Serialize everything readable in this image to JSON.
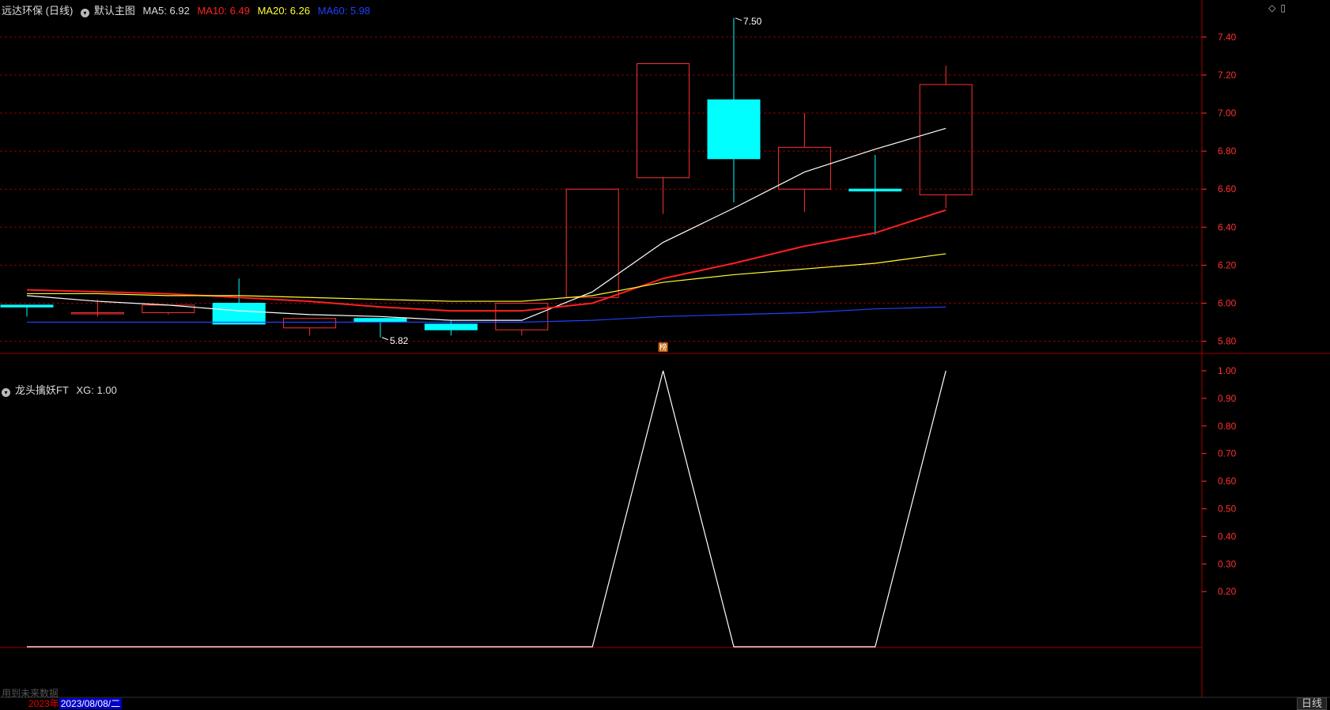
{
  "header": {
    "stock_name": "远达环保 (日线)",
    "template_label": "默认主图",
    "ma5": {
      "label": "MA5:",
      "value": "6.92",
      "color": "#ffffff"
    },
    "ma10": {
      "label": "MA10:",
      "value": "6.49",
      "color": "#ff2020"
    },
    "ma20": {
      "label": "MA20:",
      "value": "6.26",
      "color": "#ffff30"
    },
    "ma60": {
      "label": "MA60:",
      "value": "5.98",
      "color": "#2040ff"
    }
  },
  "indicator_header": {
    "name": "龙头擒妖FT",
    "xg_label": "XG:",
    "xg_value": "1.00"
  },
  "window_controls": {
    "diamond": "◇",
    "restore": "▯"
  },
  "footer": {
    "note": "用到未来数据",
    "year": "2023年",
    "current_date": "2023/08/08/二",
    "period_button": "日线"
  },
  "colors": {
    "up": "#ff3030",
    "down": "#00ffff",
    "grid": "#8b0000",
    "axis_text": "#ff3030",
    "border": "#a00000",
    "annotation": "#ffffff",
    "badge_bg": "#c06010"
  },
  "chart_data": [
    {
      "type": "candlestick",
      "title": "远达环保 (日线)",
      "ylim": [
        5.74,
        7.52
      ],
      "y_ticks": [
        "7.40",
        "7.20",
        "7.00",
        "6.80",
        "6.60",
        "6.40",
        "6.20",
        "6.00",
        "5.80"
      ],
      "y_tick_values": [
        7.4,
        7.2,
        7.0,
        6.8,
        6.6,
        6.4,
        6.2,
        6.0,
        5.8
      ],
      "grid": true,
      "candles": [
        {
          "open": 5.99,
          "close": 5.98,
          "high": 5.99,
          "low": 5.93
        },
        {
          "open": 5.95,
          "close": 5.95,
          "high": 6.02,
          "low": 5.93
        },
        {
          "open": 5.95,
          "close": 5.99,
          "high": 5.99,
          "low": 5.94
        },
        {
          "open": 6.0,
          "close": 5.89,
          "high": 6.13,
          "low": 5.89
        },
        {
          "open": 5.87,
          "close": 5.92,
          "high": 5.92,
          "low": 5.83
        },
        {
          "open": 5.92,
          "close": 5.9,
          "high": 5.92,
          "low": 5.82
        },
        {
          "open": 5.89,
          "close": 5.86,
          "high": 5.91,
          "low": 5.83
        },
        {
          "open": 5.86,
          "close": 6.0,
          "high": 6.0,
          "low": 5.83
        },
        {
          "open": 6.03,
          "close": 6.6,
          "high": 6.6,
          "low": 6.03
        },
        {
          "open": 6.66,
          "close": 7.26,
          "high": 7.26,
          "low": 6.47
        },
        {
          "open": 7.07,
          "close": 6.76,
          "high": 7.5,
          "low": 6.53
        },
        {
          "open": 6.6,
          "close": 6.82,
          "high": 7.0,
          "low": 6.48
        },
        {
          "open": 6.6,
          "close": 6.59,
          "high": 6.78,
          "low": 6.36
        },
        {
          "open": 6.57,
          "close": 7.15,
          "high": 7.25,
          "low": 6.5
        }
      ],
      "series": [
        {
          "name": "MA5",
          "color": "#ffffff",
          "values": [
            6.04,
            6.01,
            5.99,
            5.96,
            5.94,
            5.93,
            5.91,
            5.91,
            6.06,
            6.32,
            6.5,
            6.69,
            6.81,
            6.92
          ]
        },
        {
          "name": "MA10",
          "color": "#ff2020",
          "values": [
            6.07,
            6.06,
            6.05,
            6.03,
            6.01,
            5.98,
            5.96,
            5.96,
            6.0,
            6.13,
            6.21,
            6.3,
            6.37,
            6.49
          ]
        },
        {
          "name": "MA20",
          "color": "#ffff30",
          "values": [
            6.05,
            6.05,
            6.04,
            6.04,
            6.03,
            6.02,
            6.01,
            6.01,
            6.04,
            6.11,
            6.15,
            6.18,
            6.21,
            6.26
          ]
        },
        {
          "name": "MA60",
          "color": "#2040ff",
          "values": [
            5.9,
            5.9,
            5.9,
            5.9,
            5.9,
            5.9,
            5.9,
            5.9,
            5.91,
            5.93,
            5.94,
            5.95,
            5.97,
            5.98
          ]
        }
      ],
      "annotations": [
        {
          "label": "7.50",
          "candle_index": 10,
          "value": 7.5
        },
        {
          "label": "5.82",
          "candle_index": 5,
          "value": 5.82
        },
        {
          "label": "榜",
          "candle_index": 9,
          "kind": "badge"
        }
      ]
    },
    {
      "type": "line",
      "title": "龙头擒妖FT",
      "ylim": [
        0,
        1.06
      ],
      "y_ticks": [
        "1.00",
        "0.90",
        "0.80",
        "0.70",
        "0.60",
        "0.50",
        "0.40",
        "0.30",
        "0.20"
      ],
      "y_tick_values": [
        1.0,
        0.9,
        0.8,
        0.7,
        0.6,
        0.5,
        0.4,
        0.3,
        0.2
      ],
      "grid": false,
      "series": [
        {
          "name": "XG",
          "color": "#ffffff",
          "values": [
            0,
            0,
            0,
            0,
            0,
            0,
            0,
            0,
            0,
            1,
            0,
            0,
            0,
            1
          ]
        }
      ]
    }
  ]
}
